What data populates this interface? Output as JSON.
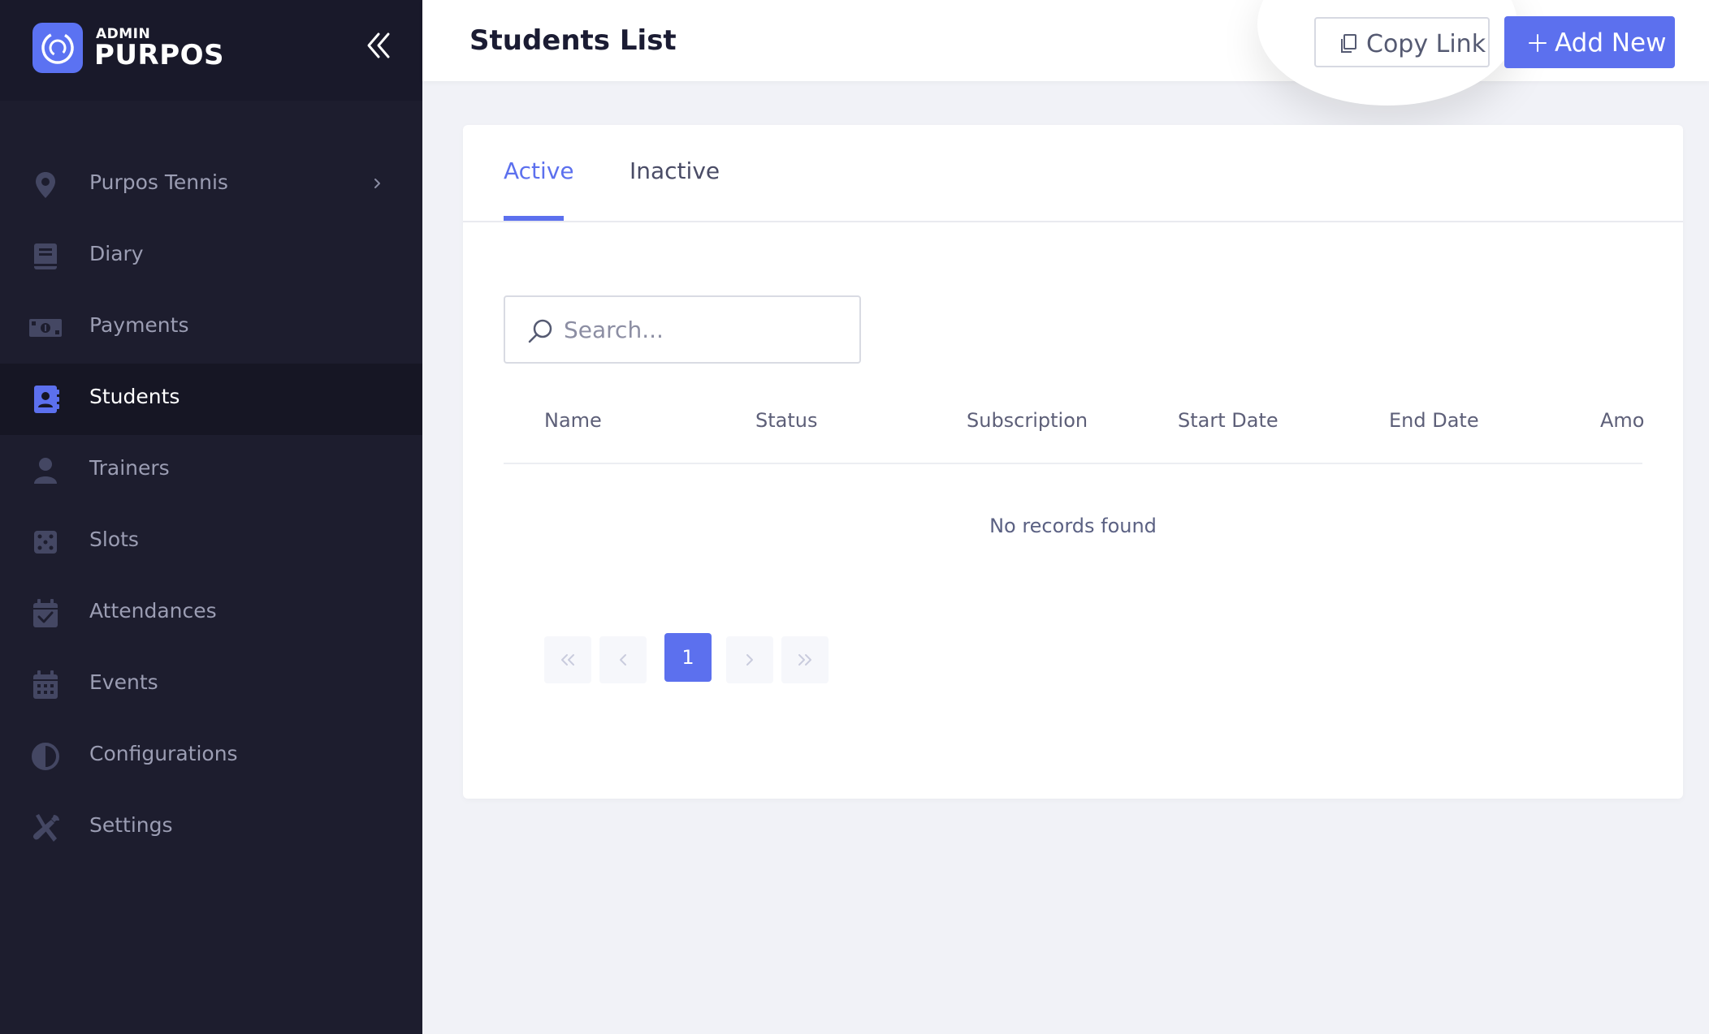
{
  "brand": {
    "small": "ADMIN",
    "name": "PURPOS"
  },
  "sidebar": {
    "items": [
      {
        "label": "Purpos Tennis",
        "icon": "map-pin-icon",
        "has_submenu": true
      },
      {
        "label": "Diary",
        "icon": "book-icon"
      },
      {
        "label": "Payments",
        "icon": "money-icon"
      },
      {
        "label": "Students",
        "icon": "contact-book-icon",
        "active": true
      },
      {
        "label": "Trainers",
        "icon": "person-icon"
      },
      {
        "label": "Slots",
        "icon": "dice-icon"
      },
      {
        "label": "Attendances",
        "icon": "calendar-check-icon"
      },
      {
        "label": "Events",
        "icon": "calendar-icon"
      },
      {
        "label": "Configurations",
        "icon": "contrast-icon"
      },
      {
        "label": "Settings",
        "icon": "tools-icon"
      }
    ]
  },
  "header": {
    "title": "Students List",
    "copy_link_label": "Copy Link",
    "add_new_label": "Add New"
  },
  "tabs": [
    {
      "label": "Active",
      "active": true
    },
    {
      "label": "Inactive",
      "active": false
    }
  ],
  "search": {
    "placeholder": "Search...",
    "value": ""
  },
  "table": {
    "columns": [
      "Name",
      "Status",
      "Subscription",
      "Start Date",
      "End Date",
      "Amo"
    ],
    "rows": [],
    "empty_message": "No records found"
  },
  "pagination": {
    "current_page": "1"
  },
  "colors": {
    "accent": "#5c70ee",
    "sidebar_bg": "#1d1d2e",
    "sidebar_active_bg": "#161624",
    "page_bg": "#f1f2f7",
    "sidebar_icon": "#444763",
    "sidebar_icon_active": "#5c70ee"
  }
}
